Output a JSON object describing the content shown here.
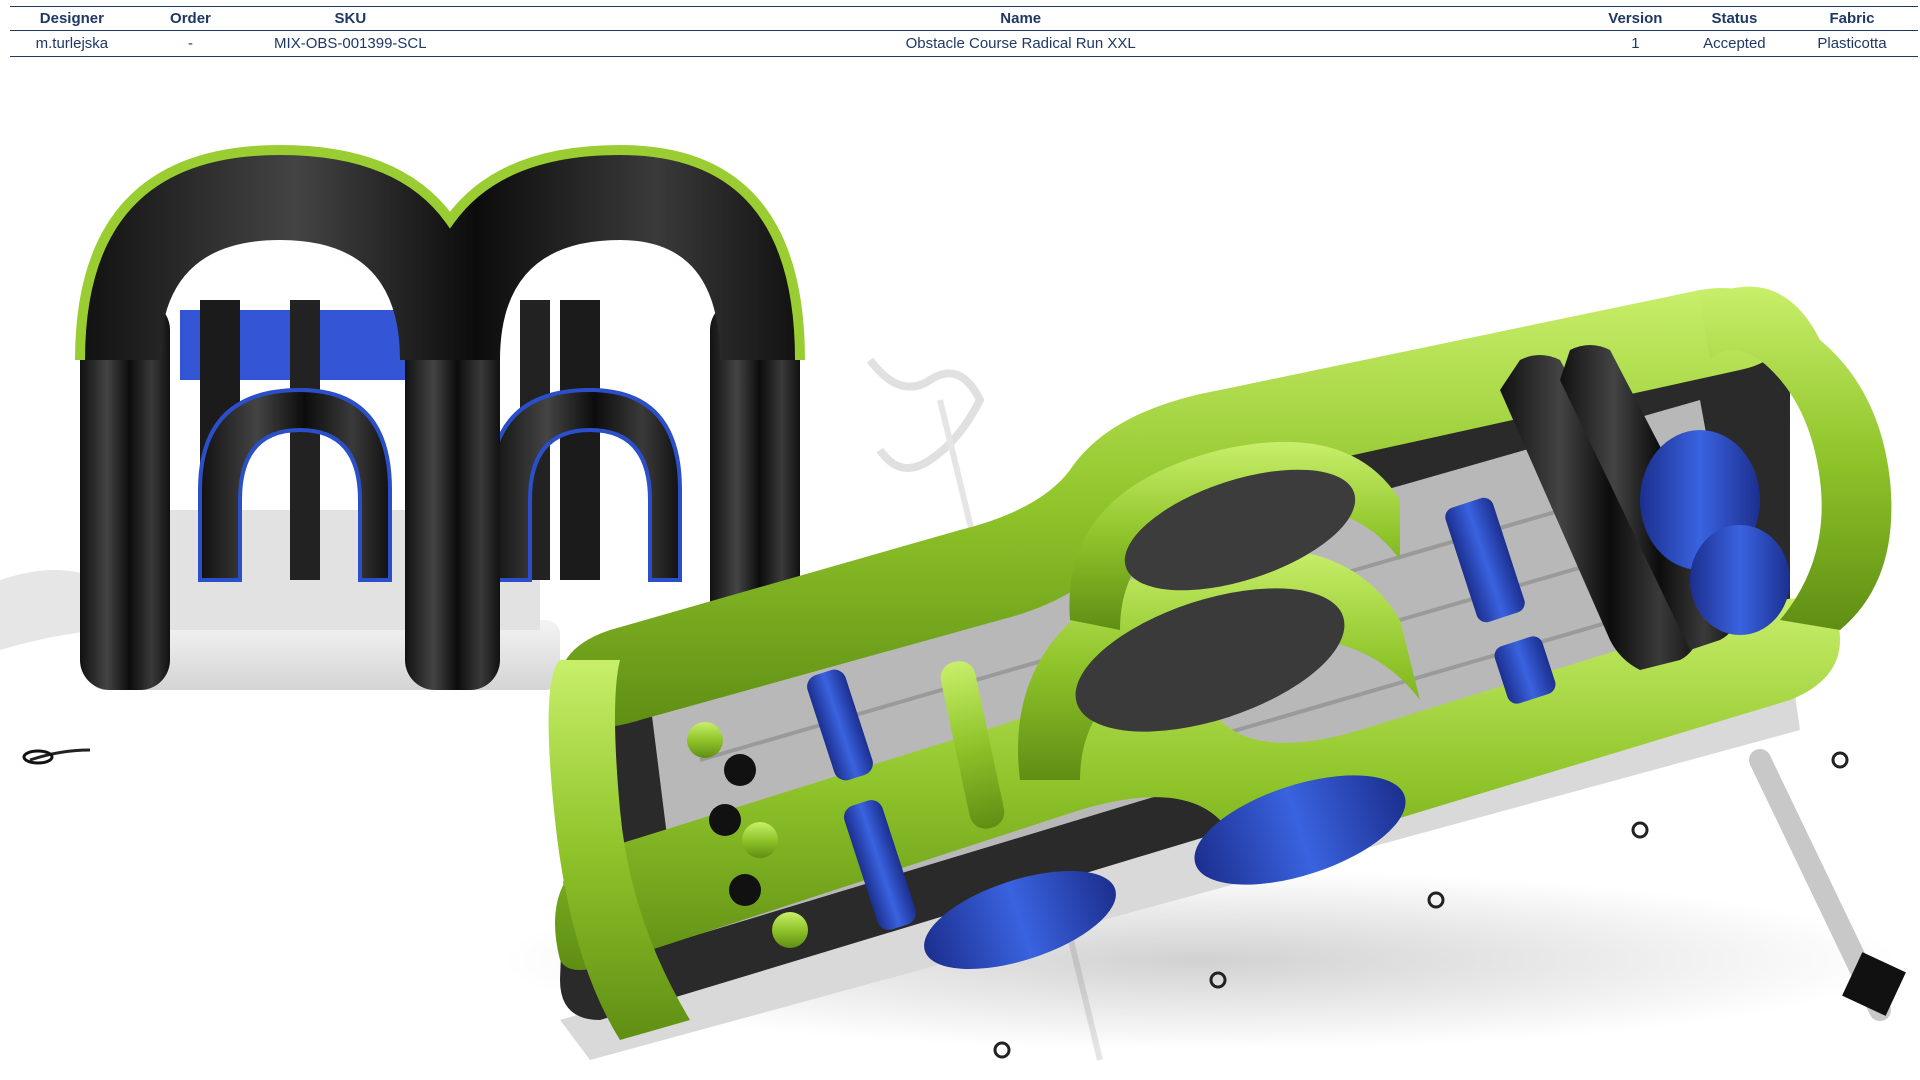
{
  "table": {
    "headers": [
      "Designer",
      "Order",
      "SKU",
      "Name",
      "Version",
      "Status",
      "Fabric"
    ],
    "row": [
      "m.turlejska",
      "-",
      "MIX-OBS-001399-SCL",
      "Obstacle Course Radical Run XXL",
      "1",
      "Accepted",
      "Plasticotta"
    ]
  },
  "colors": {
    "table_text": "#1f3864",
    "lime": "#9acd32",
    "black": "#1a1a1a",
    "blue": "#2b4fc9",
    "grey": "#bfbfbf"
  },
  "render": {
    "front_view_icon": "inflatable-front-view",
    "top_view_icon": "inflatable-top-view",
    "watermark_icon": "watermark-logo"
  }
}
